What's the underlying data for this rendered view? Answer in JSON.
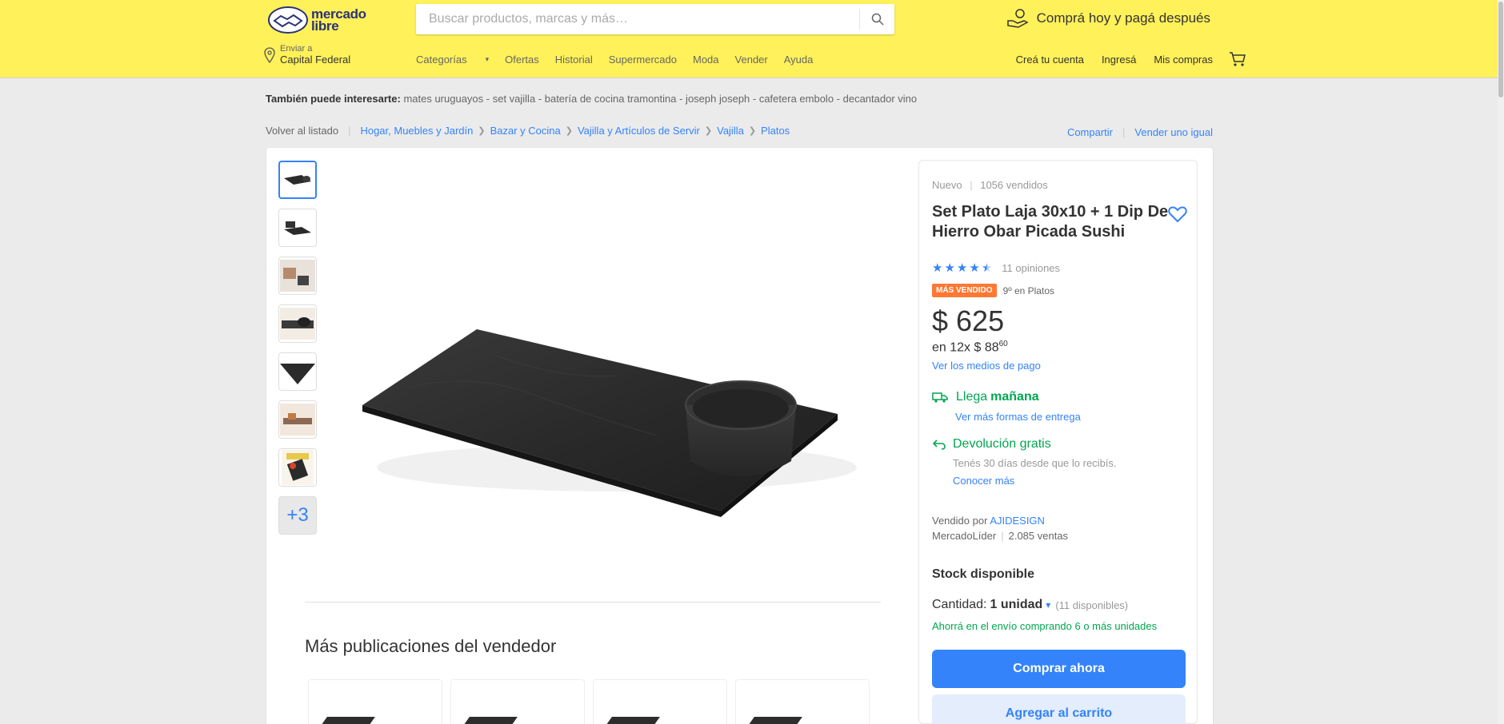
{
  "header": {
    "logo_line1": "mercado",
    "logo_line2": "libre",
    "search_placeholder": "Buscar productos, marcas y más…",
    "promo": "Comprá hoy y pagá después",
    "location_label": "Enviar a",
    "location_value": "Capital Federal",
    "nav": [
      "Categorías",
      "Ofertas",
      "Historial",
      "Supermercado",
      "Moda",
      "Vender",
      "Ayuda"
    ],
    "account": [
      "Creá tu cuenta",
      "Ingresá",
      "Mis compras"
    ],
    "colors": {
      "brand_yellow": "#fff159",
      "accent_blue": "#3483fa"
    }
  },
  "interest": {
    "label": "También puede interesarte:",
    "items": "mates uruguayos - set vajilla - batería de cocina tramontina - joseph joseph - cafetera embolo - decantador vino"
  },
  "breadcrumb": {
    "back": "Volver al listado",
    "items": [
      "Hogar, Muebles y Jardín",
      "Bazar y Cocina",
      "Vajilla y Artículos de Servir",
      "Vajilla",
      "Platos"
    ],
    "share": "Compartir",
    "sell_same": "Vender uno igual"
  },
  "gallery": {
    "more_count": "+3"
  },
  "seller_posts": {
    "title": "Más publicaciones del vendedor"
  },
  "product": {
    "condition": "Nuevo",
    "sold": "1056 vendidos",
    "title": "Set Plato Laja 30x10 + 1 Dip De Hierro Obar Picada Sushi",
    "rating": 4.5,
    "reviews": "11 opiniones",
    "badge": "MÁS VENDIDO",
    "badge_rank": "9º en Platos",
    "price": "$ 625",
    "installments_prefix": "en 12x $ 88",
    "installments_cents": "60",
    "payment_link": "Ver los medios de pago",
    "shipping_prefix": "Llega",
    "shipping_day": "mañana",
    "shipping_link": "Ver más formas de entrega",
    "return_title": "Devolución gratis",
    "return_sub": "Tenés 30 días desde que lo recibís.",
    "return_link": "Conocer más",
    "seller_prefix": "Vendido por",
    "seller_name": "AJIDESIGN",
    "seller_level": "MercadoLíder",
    "seller_sales": "2.085 ventas",
    "stock": "Stock disponible",
    "qty_label": "Cantidad:",
    "qty_value": "1 unidad",
    "qty_available": "(11 disponibles)",
    "ship_promo": "Ahorrá en el envío comprando 6 o más unidades",
    "buy_now": "Comprar ahora",
    "add_cart": "Agregar al carrito"
  }
}
